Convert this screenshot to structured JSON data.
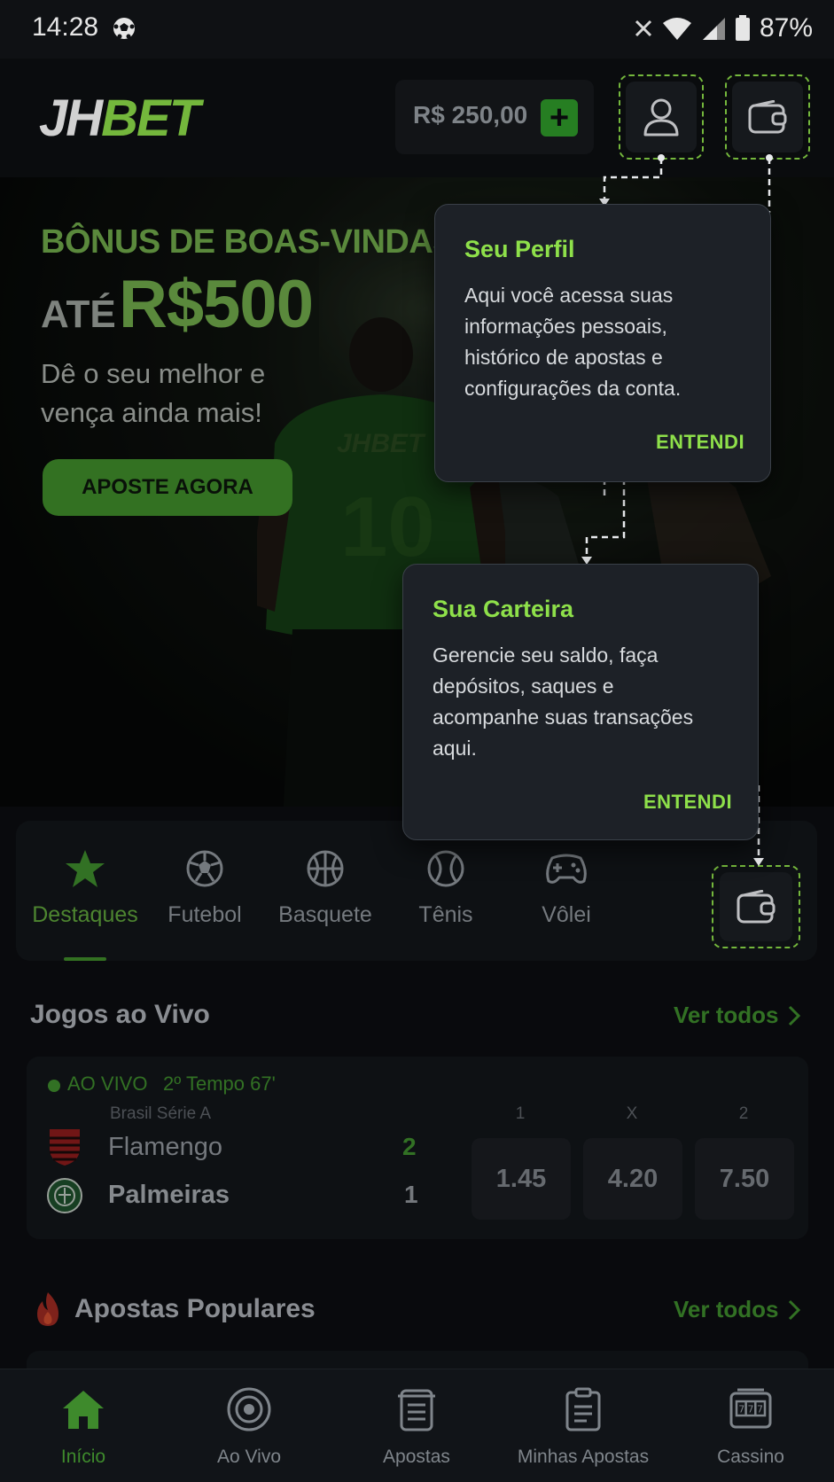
{
  "status_bar": {
    "time": "14:28",
    "battery": "87%"
  },
  "header": {
    "logo_part1": "JH",
    "logo_part2": "BET",
    "balance": "R$ 250,00",
    "add_label": "+"
  },
  "hero": {
    "bonus_title": "BÔNUS DE BOAS-VINDAS",
    "bonus_prefix": "ATÉ",
    "bonus_amount": "R$500",
    "subtitle": "Dê o seu melhor e vença ainda mais!",
    "cta": "APOSTE AGORA",
    "jersey_brand": "JHBET",
    "jersey_number": "10"
  },
  "sport_tabs": [
    {
      "label": "Destaques",
      "icon": "star-icon",
      "active": true
    },
    {
      "label": "Futebol",
      "icon": "soccer-ball-icon",
      "active": false
    },
    {
      "label": "Basquete",
      "icon": "basketball-icon",
      "active": false
    },
    {
      "label": "Tênis",
      "icon": "tennis-ball-icon",
      "active": false
    },
    {
      "label": "Vôlei",
      "icon": "gamepad-icon",
      "active": false
    }
  ],
  "live": {
    "title": "Jogos ao Vivo",
    "see_all": "Ver todos",
    "status": "AO VIVO",
    "time": "2º Tempo 67'",
    "league": "Brasil Série A",
    "home_team": "Flamengo",
    "home_score": "2",
    "away_team": "Palmeiras",
    "away_score": "1",
    "odds_headers": [
      "1",
      "X",
      "2"
    ],
    "odds": [
      "1.45",
      "4.20",
      "7.50"
    ]
  },
  "popular": {
    "title": "Apostas Populares",
    "see_all": "Ver todos"
  },
  "tooltips": {
    "profile": {
      "title": "Seu Perfil",
      "text": "Aqui você acessa suas informações pessoais, histórico de apostas e configurações da conta.",
      "button": "ENTENDI"
    },
    "wallet": {
      "title": "Sua Carteira",
      "text": "Gerencie seu saldo, faça depósitos, saques e acompanhe suas transações aqui.",
      "button": "ENTENDI"
    }
  },
  "bottom_nav": [
    {
      "label": "Início",
      "icon": "home-icon",
      "active": true
    },
    {
      "label": "Ao Vivo",
      "icon": "live-icon",
      "active": false
    },
    {
      "label": "Apostas",
      "icon": "bets-icon",
      "active": false
    },
    {
      "label": "Minhas Apostas",
      "icon": "my-bets-icon",
      "active": false
    },
    {
      "label": "Cassino",
      "icon": "slot-machine-icon",
      "active": false
    }
  ],
  "colors": {
    "accent": "#8ee04a",
    "accent_dark": "#3e8a2c",
    "background": "#0b0d10",
    "card": "#121519",
    "tooltip": "#1d2127"
  }
}
